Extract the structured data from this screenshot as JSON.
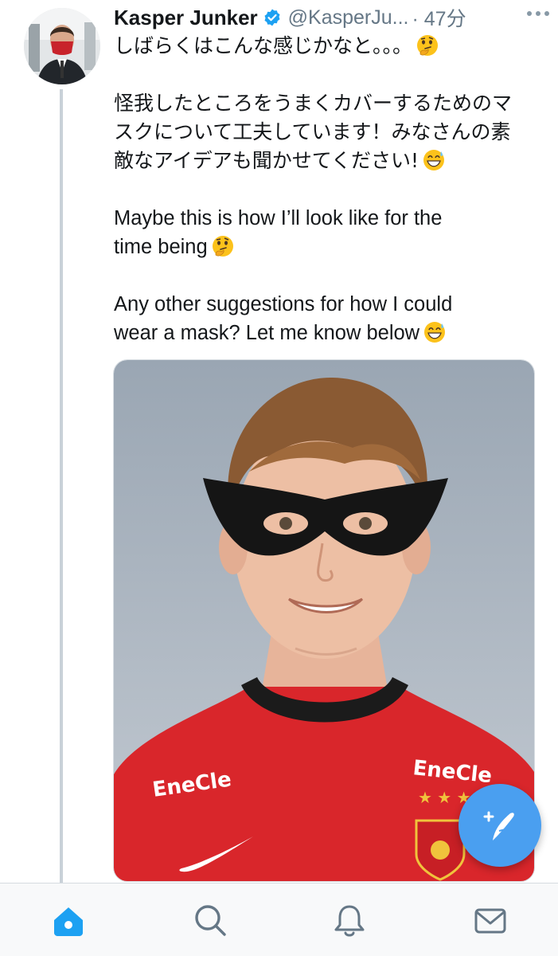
{
  "tweet": {
    "display_name": "Kasper Junker",
    "handle": "@KasperJu...",
    "timestamp": "· 47分",
    "lines_ja_1": "しばらくはこんな感じかなと。。。",
    "lines_ja_2": "怪我したところをうまくカバーするためのマ",
    "lines_ja_3": "スクについて工夫しています！みなさんの素",
    "lines_ja_4": "敵なアイデアも聞かせてください!",
    "lines_en_1": "Maybe this is how I’ll look like for the",
    "lines_en_2": "time being",
    "lines_en_3": "Any other suggestions for how I could",
    "lines_en_4": "wear a mask? Let me know below"
  },
  "media": {
    "jersey_sponsor_left": "EneCle",
    "jersey_sponsor_right": "EneCle"
  },
  "icons": {
    "verified": "verified-badge-icon",
    "more": "more-dots-icon",
    "thinking": "thinking-face-emoji",
    "sweat": "grinning-sweat-emoji",
    "compose": "compose-tweet-icon",
    "home": "home-icon",
    "search": "search-icon",
    "notifications": "bell-icon",
    "messages": "mail-icon"
  },
  "colors": {
    "accent": "#1da1f2",
    "fab": "#4a9ff0",
    "muted_text": "#657786",
    "jersey_red": "#d9262b"
  }
}
